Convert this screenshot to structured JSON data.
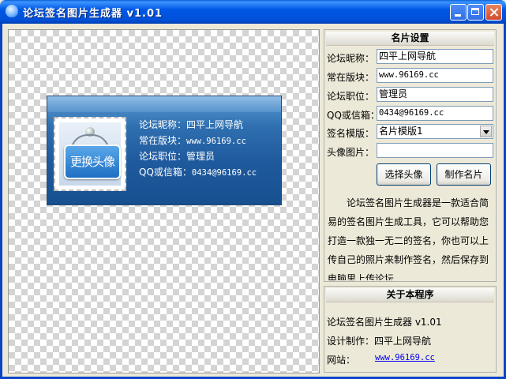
{
  "window": {
    "title": "论坛签名图片生成器 v1.01"
  },
  "preview": {
    "avatar_badge": "更换头像",
    "lines": [
      {
        "label": "论坛昵称：",
        "value": "四平上网导航"
      },
      {
        "label": "常在版块：",
        "value": "www.96169.cc"
      },
      {
        "label": "论坛职位：",
        "value": "管理员"
      },
      {
        "label": "QQ或信箱：",
        "value": "0434@96169.cc"
      }
    ]
  },
  "settings": {
    "header": "名片设置",
    "nickname_label": "论坛昵称：",
    "nickname_value": "四平上网导航",
    "board_label": "常在版块：",
    "board_value": "www.96169.cc",
    "position_label": "论坛职位：",
    "position_value": "管理员",
    "contact_label": "QQ或信箱：",
    "contact_value": "0434@96169.cc",
    "template_label": "签名模版：",
    "template_value": "名片模版1",
    "avatar_label": "头像图片：",
    "avatar_value": "",
    "choose_avatar_button": "选择头像",
    "make_card_button": "制作名片",
    "description": "论坛签名图片生成器是一款适合简易的签名图片生成工具，它可以帮助您打造一款独一无二的签名，你也可以上传自己的照片来制作签名，然后保存到电脑里上传论坛"
  },
  "about": {
    "header": "关于本程序",
    "app_line": "论坛签名图片生成器 v1.01",
    "author_line": "设计制作：四平上网导航",
    "website_label": "网站：",
    "website_url": "www.96169.cc"
  }
}
